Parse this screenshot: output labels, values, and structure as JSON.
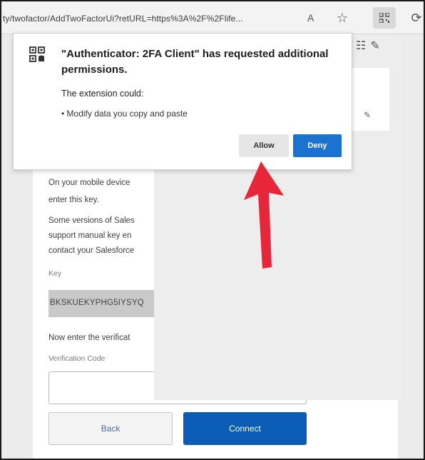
{
  "browser": {
    "url": "ty/twofactor/AddTwoFactorUi?retURL=https%3A%2F%2Flife...",
    "icons": [
      "read-aloud-icon",
      "star-icon",
      "qr-extension-icon",
      "refresh-icon"
    ]
  },
  "dialog": {
    "title": "\"Authenticator: 2FA Client\" has requested additional permissions.",
    "subtitle": "The extension could:",
    "permission": "• Modify data you copy and paste",
    "allow_label": "Allow",
    "deny_label": "Deny",
    "deny_color": "#1a73d1"
  },
  "page": {
    "line1": "On your mobile device",
    "line2": "enter this key.",
    "line3": "Some versions of Sales",
    "line4": "support manual key en",
    "line5": "contact your Salesforce",
    "key_label": "Key",
    "key_value": "BKSKUEKYPHG5IYSYQ",
    "verify_prompt": "Now enter the verificat",
    "code_label": "Verification Code",
    "back_label": "Back",
    "connect_label": "Connect",
    "connect_color": "#0a5cb5"
  },
  "annotation": {
    "arrow_color": "#e8263a"
  }
}
